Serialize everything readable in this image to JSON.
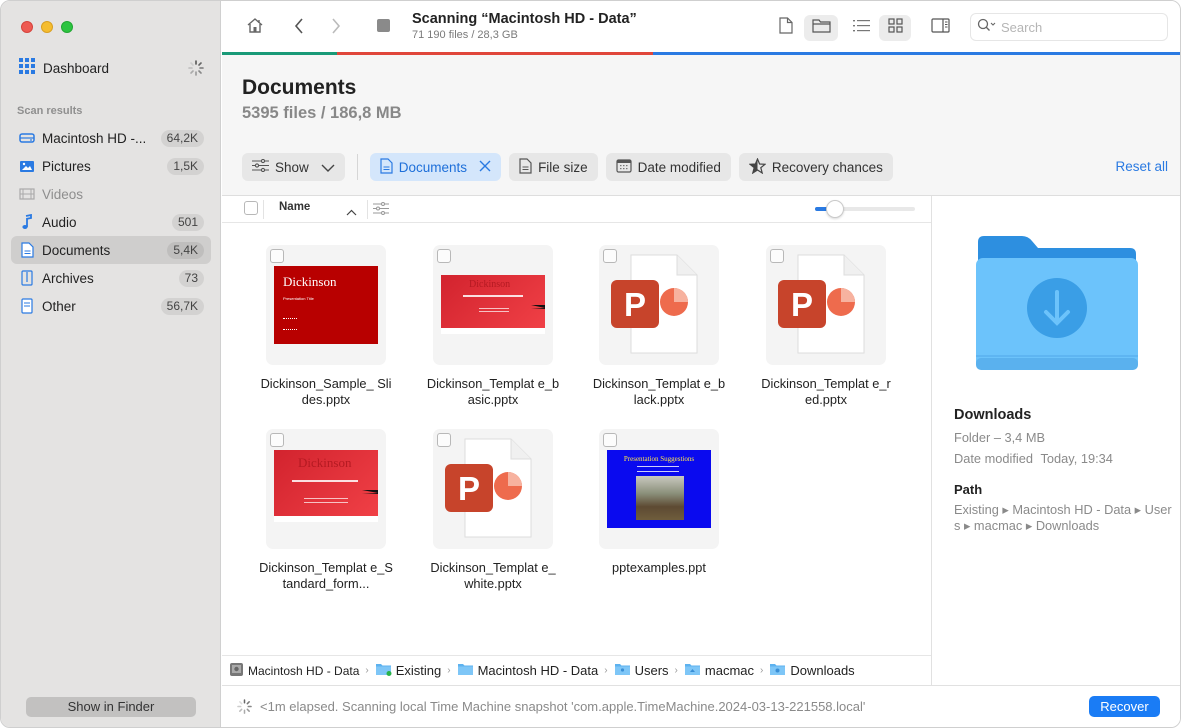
{
  "window": {
    "title": "Scanning “Macintosh HD - Data”",
    "subtitle": "71 190 files / 28,3 GB",
    "scan_progress_segments": [
      {
        "name": "green",
        "color": "#1a9a78",
        "fraction": 0.12
      },
      {
        "name": "red",
        "color": "#e0463b",
        "fraction": 0.33
      },
      {
        "name": "blue",
        "color": "#2a7ae2",
        "fraction": 0.55
      }
    ]
  },
  "sidebar": {
    "dashboard_label": "Dashboard",
    "section_label": "Scan results",
    "items": [
      {
        "label": "Macintosh HD -...",
        "count": "64,2K",
        "icon": "drive-icon",
        "active": false,
        "disabled": false
      },
      {
        "label": "Pictures",
        "count": "1,5K",
        "icon": "picture-icon",
        "active": false,
        "disabled": false
      },
      {
        "label": "Videos",
        "count": "",
        "icon": "film-icon",
        "active": false,
        "disabled": true
      },
      {
        "label": "Audio",
        "count": "501",
        "icon": "music-note-icon",
        "active": false,
        "disabled": false
      },
      {
        "label": "Documents",
        "count": "5,4K",
        "icon": "document-icon",
        "active": true,
        "disabled": false
      },
      {
        "label": "Archives",
        "count": "73",
        "icon": "archive-icon",
        "active": false,
        "disabled": false
      },
      {
        "label": "Other",
        "count": "56,7K",
        "icon": "other-file-icon",
        "active": false,
        "disabled": false
      }
    ],
    "show_in_finder": "Show in Finder"
  },
  "toolbar": {
    "search_placeholder": "Search"
  },
  "header": {
    "title": "Documents",
    "subtitle": "5395 files / 186,8 MB",
    "filters": {
      "show": "Show",
      "documents": "Documents",
      "file_size": "File size",
      "date_modified": "Date modified",
      "recovery_chances": "Recovery chances"
    },
    "reset_all": "Reset all"
  },
  "list": {
    "name_header": "Name",
    "zoom_slider_fraction": 0.2,
    "files": [
      {
        "name": "Dickinson_Sample_ Slides.pptx",
        "thumb": "dickinson-red"
      },
      {
        "name": "Dickinson_Templat e_basic.pptx",
        "thumb": "dickinson-wide"
      },
      {
        "name": "Dickinson_Templat e_black.pptx",
        "thumb": "ppt-icon"
      },
      {
        "name": "Dickinson_Templat e_red.pptx",
        "thumb": "ppt-icon"
      },
      {
        "name": "Dickinson_Templat e_Standard_form...",
        "thumb": "dickinson-standard"
      },
      {
        "name": "Dickinson_Templat e_white.pptx",
        "thumb": "ppt-icon"
      },
      {
        "name": "pptexamples.ppt",
        "thumb": "presentation-blue"
      }
    ],
    "thumb_texts": {
      "dickinson": "Dickinson",
      "presentation_title": "Presentation Title",
      "presentation_suggestions": "Presentation Suggestions"
    }
  },
  "details": {
    "name": "Downloads",
    "kind_size": "Folder – 3,4 MB",
    "date_label": "Date modified",
    "date_value": "Today, 19:34",
    "path_label": "Path",
    "path_value": "Existing ▸ Macintosh HD - Data ▸ Users ▸ macmac ▸ Downloads"
  },
  "breadcrumb": [
    {
      "label": "Macintosh HD - Data",
      "icon": "disk-icon"
    },
    {
      "label": "Existing",
      "icon": "folder-check-icon"
    },
    {
      "label": "Macintosh HD - Data",
      "icon": "folder-icon"
    },
    {
      "label": "Users",
      "icon": "users-folder-icon"
    },
    {
      "label": "macmac",
      "icon": "home-folder-icon"
    },
    {
      "label": "Downloads",
      "icon": "downloads-folder-icon"
    }
  ],
  "status": {
    "text": "<1m elapsed. Scanning local Time Machine snapshot 'com.apple.TimeMachine.2024-03-13-221558.local'",
    "recover_label": "Recover"
  }
}
